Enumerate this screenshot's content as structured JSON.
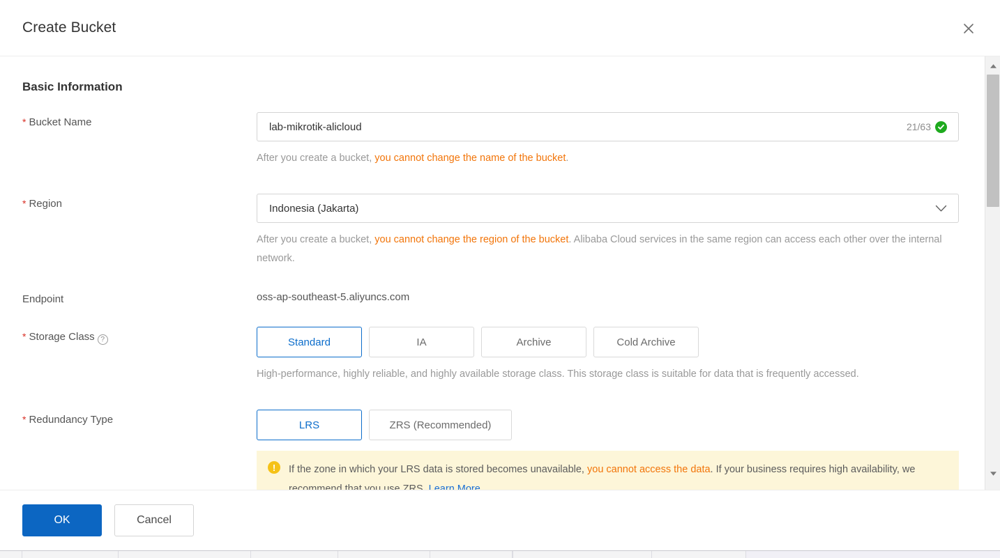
{
  "dialog": {
    "title": "Create Bucket",
    "close_icon": "close-icon"
  },
  "section": {
    "title": "Basic Information"
  },
  "bucket_name": {
    "label": "Bucket Name",
    "required_marker": "*",
    "value": "lab-mikrotik-alicloud",
    "placeholder": "",
    "counter": "21/63",
    "valid_icon": "check-circle-icon",
    "hint_prefix": "After you create a bucket, ",
    "hint_warn": "you cannot change the name of the bucket",
    "hint_suffix": "."
  },
  "region": {
    "label": "Region",
    "required_marker": "*",
    "value": "Indonesia (Jakarta)",
    "dropdown_icon": "chevron-down-icon",
    "hint_prefix": "After you create a bucket, ",
    "hint_warn": "you cannot change the region of the bucket",
    "hint_suffix": ". Alibaba Cloud services in the same region can access each other over the internal network."
  },
  "endpoint": {
    "label": "Endpoint",
    "value": "oss-ap-southeast-5.aliyuncs.com"
  },
  "storage_class": {
    "label": "Storage Class",
    "required_marker": "*",
    "help_icon": "question-circle-icon",
    "help_glyph": "?",
    "options": [
      {
        "label": "Standard",
        "selected": true
      },
      {
        "label": "IA",
        "selected": false
      },
      {
        "label": "Archive",
        "selected": false
      },
      {
        "label": "Cold Archive",
        "selected": false
      }
    ],
    "description": "High-performance, highly reliable, and highly available storage class. This storage class is suitable for data that is frequently accessed."
  },
  "redundancy_type": {
    "label": "Redundancy Type",
    "required_marker": "*",
    "options": [
      {
        "label": "LRS",
        "selected": true
      },
      {
        "label": "ZRS (Recommended)",
        "selected": false
      }
    ],
    "warning": {
      "icon": "warning-icon",
      "glyph": "!",
      "text_1": "If the zone in which your LRS data is stored becomes unavailable, ",
      "text_hot": "you cannot access the data",
      "text_2": ". If your business requires high availability, we recommend that you use ZRS. ",
      "link": "Learn More"
    }
  },
  "footer": {
    "ok_label": "OK",
    "cancel_label": "Cancel"
  },
  "scrollbar": {
    "up_icon": "caret-up-icon",
    "down_icon": "caret-down-icon",
    "thumb": "scroll-thumb"
  },
  "colors": {
    "accent": "#0c6dcb",
    "primary_button": "#0c66c2",
    "warn_text": "#f2750a",
    "success": "#1eaa1e",
    "warn_banner_bg": "#fdf6d9",
    "warn_icon": "#f5c218",
    "required": "#d93026"
  }
}
